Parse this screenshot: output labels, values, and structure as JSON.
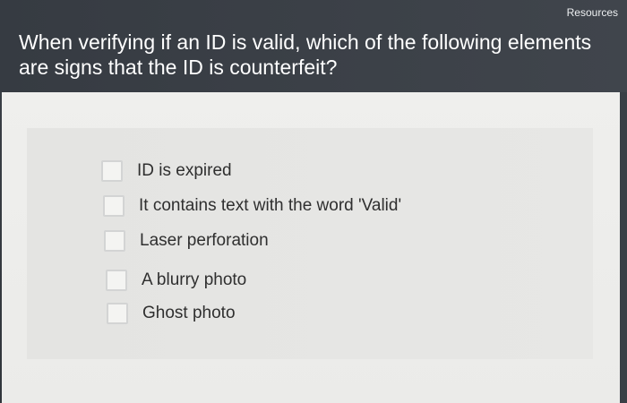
{
  "header": {
    "resources_label": "Resources",
    "question": "When verifying if an ID is valid, which of the following elements are signs that the ID is counterfeit?"
  },
  "options": [
    {
      "label": "ID is expired",
      "checked": false
    },
    {
      "label": "It contains text with the word 'Valid'",
      "checked": false
    },
    {
      "label": "Laser perforation",
      "checked": false
    },
    {
      "label": "A blurry photo",
      "checked": false
    },
    {
      "label": "Ghost photo",
      "checked": false
    }
  ]
}
